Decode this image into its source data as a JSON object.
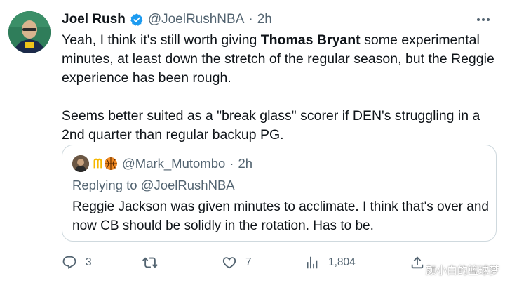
{
  "author": {
    "name": "Joel Rush",
    "handle": "@JoelRushNBA",
    "separator": "·",
    "time": "2h",
    "verified_color": "#1d9bf0"
  },
  "body": {
    "line1_pre": "Yeah, I think it's still worth giving ",
    "line1_bold": "Thomas Bryant",
    "line1_post": " some experimental minutes, at least down the stretch of the regular season, but the Reggie experience has been rough.",
    "paragraph2": "Seems better suited as a \"break glass\" scorer if DEN's struggling in a 2nd quarter than regular backup PG."
  },
  "quote": {
    "emoji_text": "ᗰ",
    "handle": "@Mark_Mutombo",
    "separator": "·",
    "time": "2h",
    "replying_to": "Replying to @JoelRushNBA",
    "text": "Reggie Jackson was given minutes to acclimate. I think that's over and now CB should be solidly in the rotation. Has to be."
  },
  "actions": {
    "reply_count": "3",
    "retweet_count": "",
    "like_count": "7",
    "views_count": "1,804"
  },
  "watermark": {
    "text": "颜小白的篮球梦"
  },
  "icons": {
    "reply": "reply-icon",
    "retweet": "retweet-icon",
    "like": "heart-icon",
    "views": "views-icon",
    "share": "share-icon",
    "more": "more-icon",
    "verified": "verified-badge-icon"
  },
  "colors": {
    "text": "#0f1419",
    "secondary": "#536471",
    "border": "#cfd9de",
    "verified": "#1d9bf0"
  }
}
